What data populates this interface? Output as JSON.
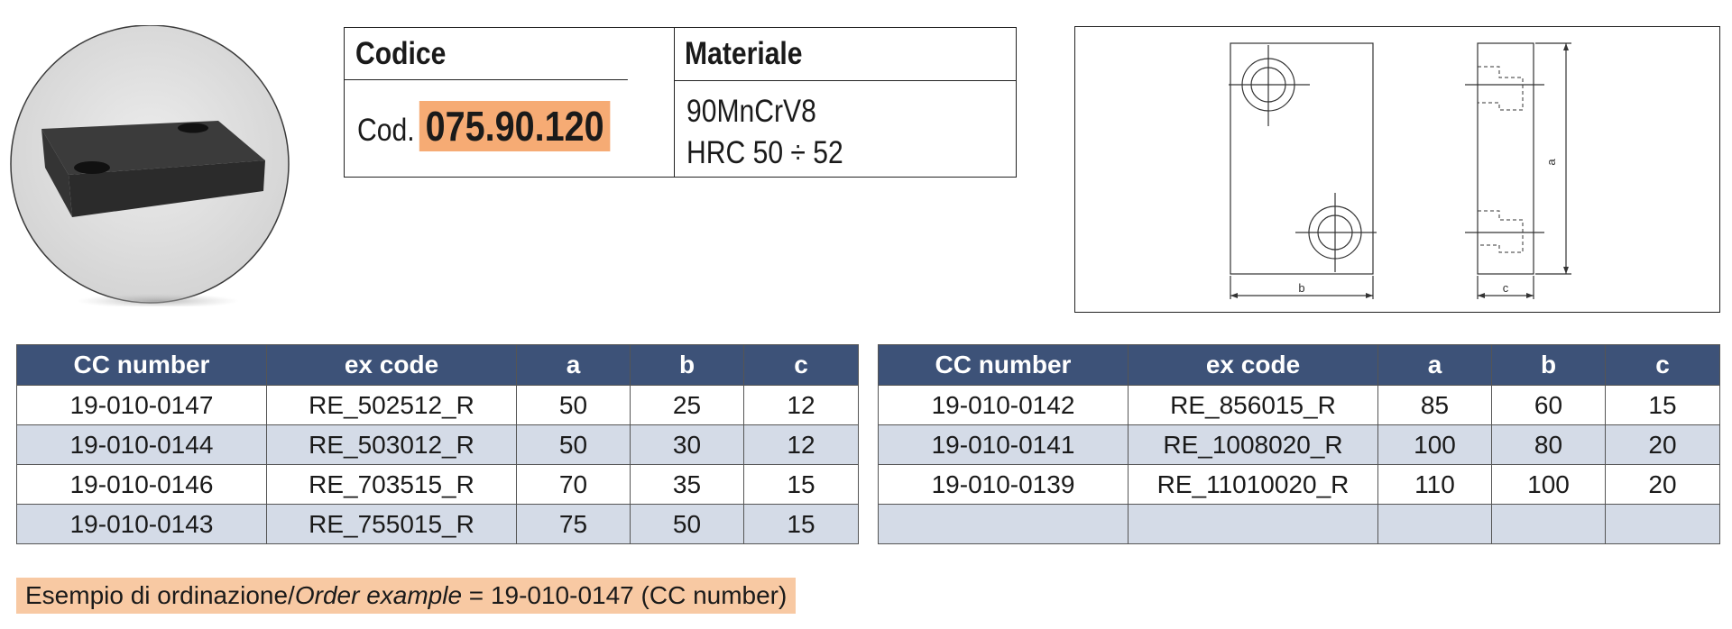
{
  "info_box": {
    "code_header": "Codice",
    "material_header": "Materiale",
    "code_prefix": "Cod.",
    "code_value": "075.90.120",
    "material_name": "90MnCrV8",
    "hardness": "HRC 50 ÷ 52"
  },
  "drawing": {
    "dim_a": "a",
    "dim_b": "b",
    "dim_c": "c"
  },
  "table_left": {
    "headers": [
      "CC number",
      "ex code",
      "a",
      "b",
      "c"
    ],
    "rows": [
      [
        "19-010-0147",
        "RE_502512_R",
        "50",
        "25",
        "12"
      ],
      [
        "19-010-0144",
        "RE_503012_R",
        "50",
        "30",
        "12"
      ],
      [
        "19-010-0146",
        "RE_703515_R",
        "70",
        "35",
        "15"
      ],
      [
        "19-010-0143",
        "RE_755015_R",
        "75",
        "50",
        "15"
      ]
    ]
  },
  "table_right": {
    "headers": [
      "CC number",
      "ex code",
      "a",
      "b",
      "c"
    ],
    "rows": [
      [
        "19-010-0142",
        "RE_856015_R",
        "85",
        "60",
        "15"
      ],
      [
        "19-010-0141",
        "RE_1008020_R",
        "100",
        "80",
        "20"
      ],
      [
        "19-010-0139",
        "RE_11010020_R",
        "110",
        "100",
        "20"
      ],
      [
        "",
        "",
        "",
        "",
        ""
      ]
    ]
  },
  "order_example": {
    "label_it": "Esempio di ordinazione/",
    "label_en": "Order example",
    "value": " = 19-010-0147 (CC number)"
  },
  "colors": {
    "header_bg": "#3d5278",
    "alt_row_bg": "#d4dbe7",
    "code_highlight": "#f6ab74",
    "order_bg": "#f8c9a3"
  }
}
